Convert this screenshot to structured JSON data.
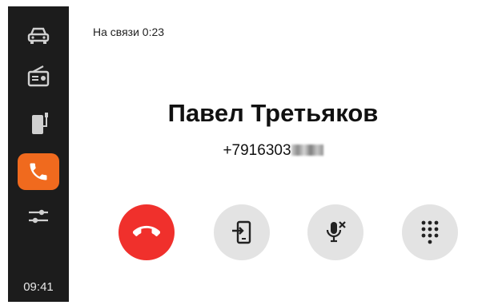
{
  "colors": {
    "sidebar_bg": "#1c1c1c",
    "accent": "#f06a1e",
    "end_call": "#f0302c",
    "button_gray": "#e3e3e3"
  },
  "sidebar": {
    "items": [
      {
        "icon": "car-icon",
        "active": false
      },
      {
        "icon": "radio-icon",
        "active": false
      },
      {
        "icon": "phone-charging-icon",
        "active": false
      },
      {
        "icon": "phone-icon",
        "active": true
      },
      {
        "icon": "settings-sliders-icon",
        "active": false
      }
    ],
    "clock": "09:41"
  },
  "call": {
    "status": "На связи 0:23",
    "contact_name": "Павел Третьяков",
    "phone_visible": "+7916303"
  },
  "controls": [
    {
      "icon": "end-call-icon"
    },
    {
      "icon": "transfer-to-phone-icon"
    },
    {
      "icon": "mute-microphone-icon"
    },
    {
      "icon": "keypad-icon"
    }
  ]
}
